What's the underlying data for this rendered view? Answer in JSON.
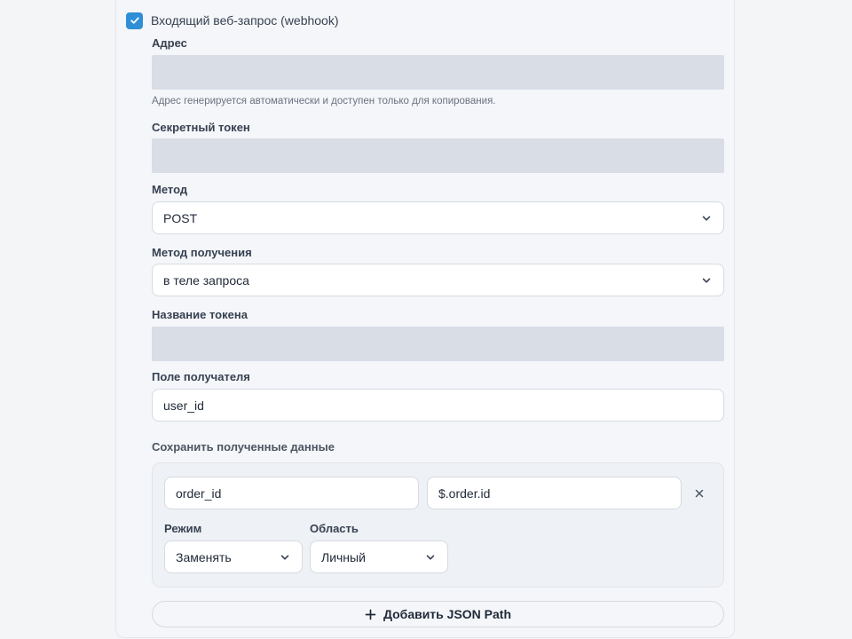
{
  "webhook": {
    "checkbox_label": "Входящий веб-запрос (webhook)",
    "checked": true
  },
  "address": {
    "label": "Адрес",
    "hint": "Адрес генерируется автоматически и доступен только для копирования."
  },
  "secret_token": {
    "label": "Секретный токен"
  },
  "method": {
    "label": "Метод",
    "value": "POST"
  },
  "receive_method": {
    "label": "Метод получения",
    "value": "в теле запроса"
  },
  "token_name": {
    "label": "Название токена"
  },
  "recipient_field": {
    "label": "Поле получателя",
    "value": "user_id"
  },
  "save_data": {
    "label": "Сохранить полученные данные",
    "rows": [
      {
        "name": "order_id",
        "path": "$.order.id",
        "mode_label": "Режим",
        "mode_value": "Заменять",
        "scope_label": "Область",
        "scope_value": "Личный"
      }
    ]
  },
  "add_json_path": {
    "label": "Добавить JSON Path"
  },
  "colors": {
    "accent": "#2f8fd6",
    "disabled_field": "#d8dde6",
    "panel_bg": "#f4f6f9"
  }
}
